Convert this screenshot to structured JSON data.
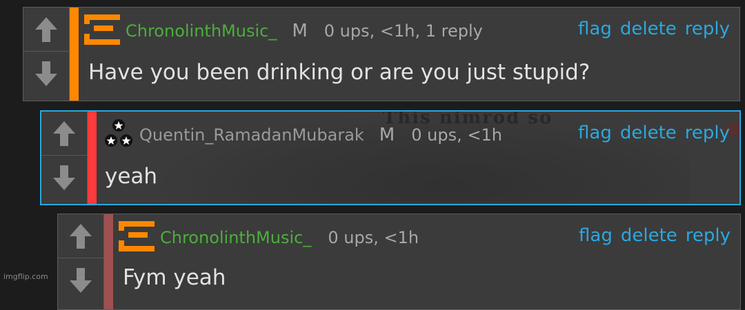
{
  "colors": {
    "accent_first": "#ff8800",
    "accent_second": "#ff3b3b",
    "accent_third": "#a05050",
    "username_green": "#4cae3c",
    "action_blue": "#2aa8df",
    "highlight_border": "#2aa8df"
  },
  "comments": [
    {
      "avatar_icon": "orange-z-icon",
      "username": "ChronolinthMusic_",
      "mod_badge": "M",
      "meta": "0 ups, <1h, 1 reply",
      "actions": [
        "flag",
        "delete",
        "reply"
      ],
      "text": "Have you been drinking or are you just stupid?"
    },
    {
      "avatar_icon": "three-stars-icon",
      "username": "Quentin_RamadanMubarak",
      "mod_badge": "M",
      "meta": "0 ups, <1h",
      "actions": [
        "flag",
        "delete",
        "reply"
      ],
      "text": "yeah",
      "background_text": "This nimrod so"
    },
    {
      "avatar_icon": "orange-z-icon",
      "username": "ChronolinthMusic_",
      "mod_badge": "",
      "meta": "0 ups, <1h",
      "actions": [
        "flag",
        "delete",
        "reply"
      ],
      "text": "Fym yeah"
    }
  ],
  "watermark": "imgflip.com"
}
